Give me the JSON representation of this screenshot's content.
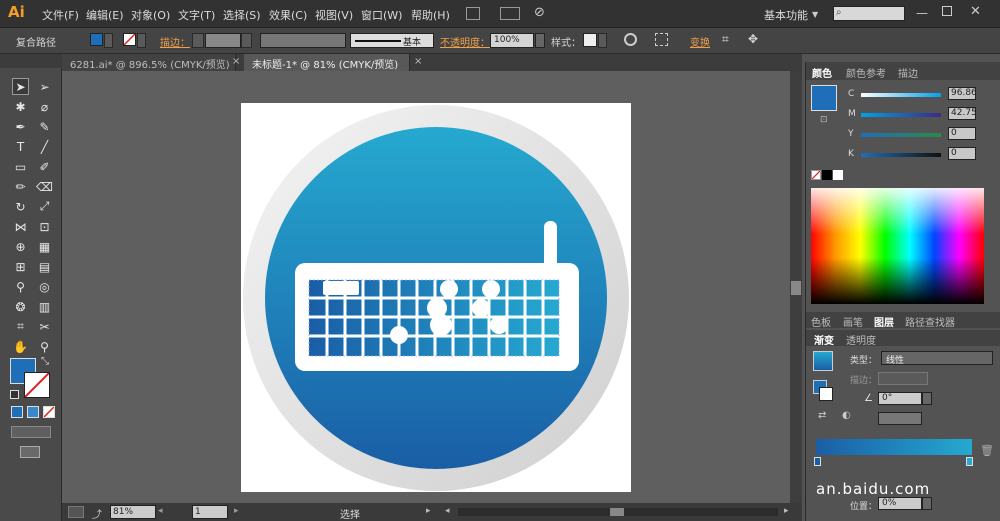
{
  "app": {
    "logo": "Ai"
  },
  "menu": [
    "文件(F)",
    "编辑(E)",
    "对象(O)",
    "文字(T)",
    "选择(S)",
    "效果(C)",
    "视图(V)",
    "窗口(W)",
    "帮助(H)"
  ],
  "workspace": "基本功能",
  "control_bar": {
    "object_type": "复合路径",
    "stroke_label": "描边：",
    "stroke_profile": "基本",
    "opacity_label": "不透明度：",
    "opacity_value": "100%",
    "style_label": "样式：",
    "transform_label": "变换"
  },
  "tabs": [
    {
      "label": "6281.ai* @ 896.5% (CMYK/预览)",
      "active": false
    },
    {
      "label": "未标题-1* @ 81% (CMYK/预览)",
      "active": true
    }
  ],
  "status": {
    "zoom": "81%",
    "page": "1",
    "tool": "选择"
  },
  "color_panel": {
    "tabs": [
      "颜色",
      "颜色参考",
      "描边"
    ],
    "channels": [
      {
        "label": "C",
        "value": "96.86"
      },
      {
        "label": "M",
        "value": "42.75"
      },
      {
        "label": "Y",
        "value": "0"
      },
      {
        "label": "K",
        "value": "0"
      }
    ],
    "fill_color": "#1e6fb8"
  },
  "layers_tabs": [
    "色板",
    "画笔",
    "图层",
    "路径查找器"
  ],
  "gradient_panel": {
    "tabs": [
      "渐变",
      "透明度"
    ],
    "type_label": "类型：",
    "type_value": "线性",
    "stroke_label": "描边：",
    "angle_value": "0°",
    "location_label": "位置：",
    "location_value": "0%"
  },
  "watermark": "an.baidu.com",
  "colors": {
    "accent": "#f29f26",
    "circle_top": "#25a9d0",
    "circle_bottom": "#1a5ea6"
  }
}
